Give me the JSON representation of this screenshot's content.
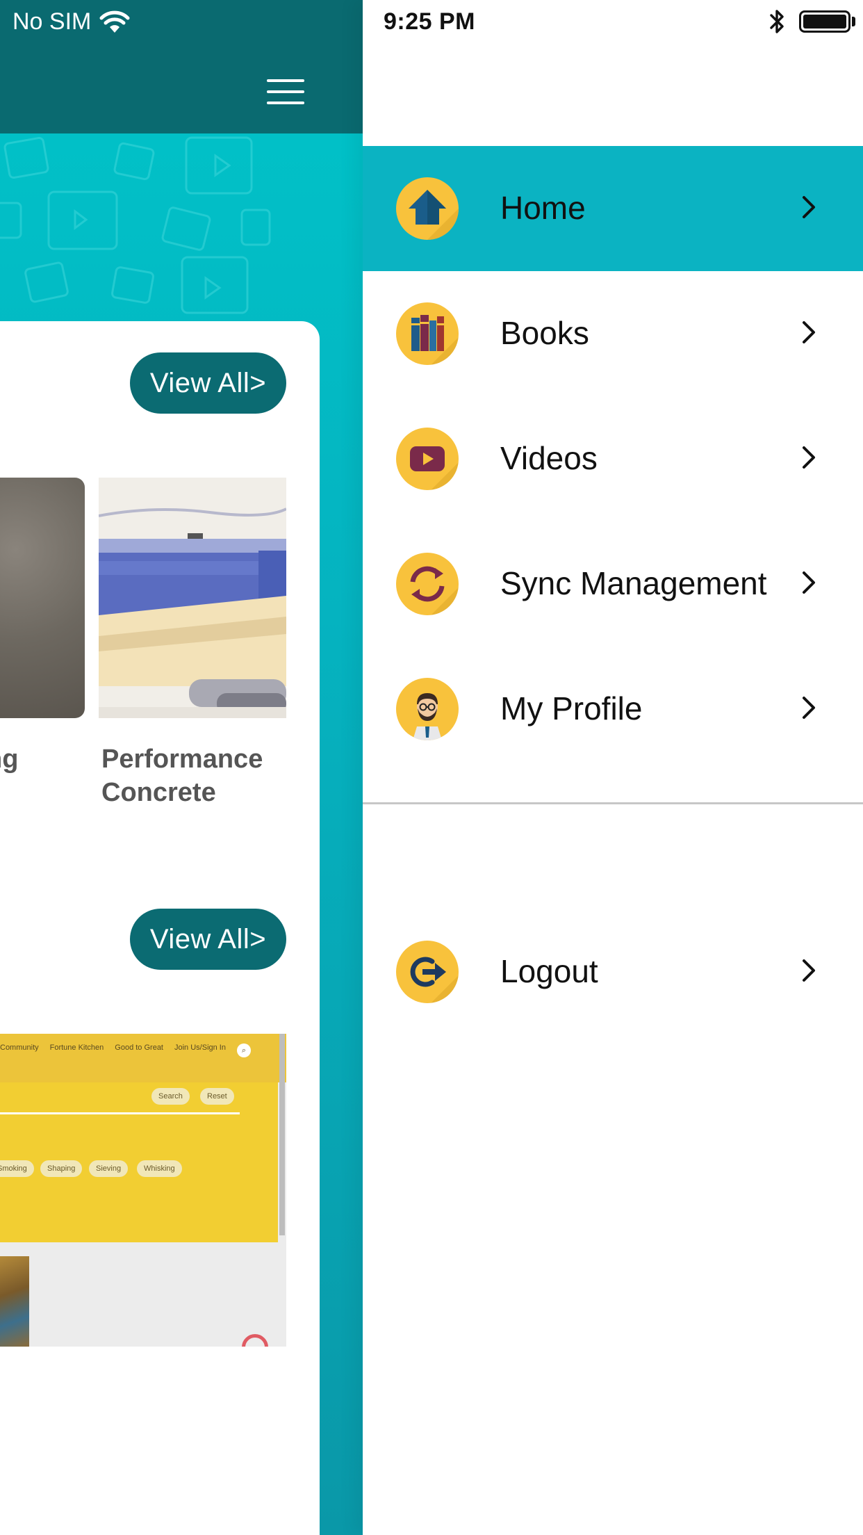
{
  "status_bar": {
    "carrier": "No SIM",
    "time": "9:25 PM"
  },
  "background_app": {
    "sections": [
      {
        "view_all_label": "View All>"
      },
      {
        "view_all_label": "View All>"
      }
    ],
    "books": [
      {
        "title": "ng"
      },
      {
        "title": "Performance Concrete"
      }
    ],
    "video_thumb": {
      "nav_items": [
        "Community",
        "Fortune Kitchen",
        "Good to Great",
        "Join Us/Sign In"
      ],
      "buttons": [
        "Search",
        "Reset"
      ],
      "pills": [
        "Smoking",
        "Shaping",
        "Sieving",
        "Whisking"
      ]
    }
  },
  "drawer": {
    "menu": [
      {
        "label": "Home",
        "icon": "home-icon",
        "active": true
      },
      {
        "label": "Books",
        "icon": "books-icon",
        "active": false
      },
      {
        "label": "Videos",
        "icon": "video-play-icon",
        "active": false
      },
      {
        "label": "Sync Management",
        "icon": "sync-icon",
        "active": false
      },
      {
        "label": "My Profile",
        "icon": "profile-avatar-icon",
        "active": false
      }
    ],
    "logout": {
      "label": "Logout",
      "icon": "logout-icon"
    }
  },
  "colors": {
    "header_teal": "#0a6a70",
    "active_teal": "#0bb3c2",
    "icon_yellow": "#f8c23c",
    "icon_maroon": "#7a2a4a",
    "view_all_bg": "#0b6b72"
  }
}
